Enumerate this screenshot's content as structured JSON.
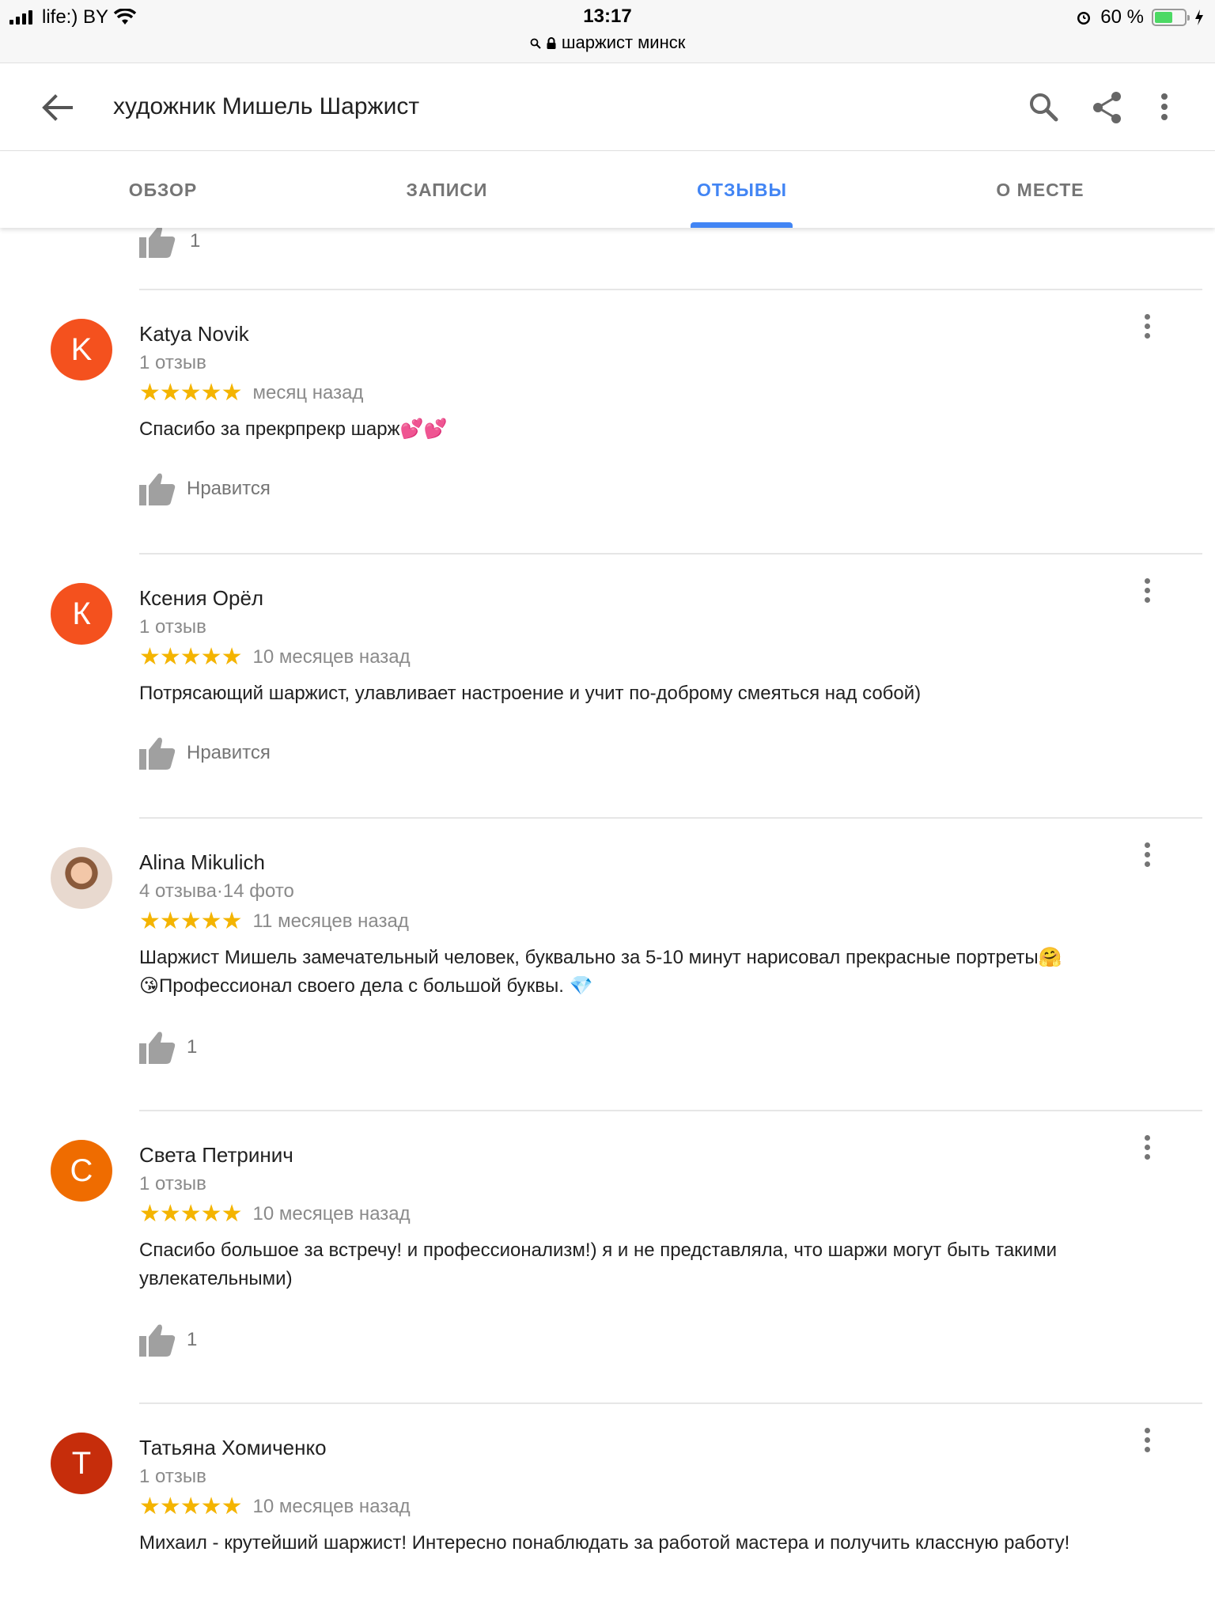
{
  "status_bar": {
    "carrier": "life:) BY",
    "time": "13:17",
    "url": "шаржист минск",
    "battery": "60 %",
    "battery_level": 0.6
  },
  "app_bar": {
    "title": "художник Мишель Шаржист",
    "icons": [
      "back-arrow-icon",
      "search-icon",
      "share-icon",
      "more-vert-icon"
    ]
  },
  "tabs": [
    {
      "label": "ОБЗОР",
      "active": false
    },
    {
      "label": "ЗАПИСИ",
      "active": false
    },
    {
      "label": "ОТЗЫВЫ",
      "active": true
    },
    {
      "label": "О МЕСТЕ",
      "active": false
    }
  ],
  "accent_color": "#4285f4",
  "star_color": "#f4b400",
  "previous_review_likes": "1",
  "reviews": [
    {
      "author": "Katya Novik",
      "avatar_letter": "K",
      "avatar_color": "#f4511e",
      "meta": "1 отзыв",
      "stars": "★★★★★",
      "date": "месяц назад",
      "text": "Спасибо за прекрпрекр шарж💕💕",
      "like": "Нравится"
    },
    {
      "author": "Ксения Орёл",
      "avatar_letter": "К",
      "avatar_color": "#f4511e",
      "meta": "1 отзыв",
      "stars": "★★★★★",
      "date": "10 месяцев назад",
      "text": "Потрясающий шаржист,  улавливает настроение и учит по-доброму смеяться над собой)",
      "like": "Нравится"
    },
    {
      "author": "Alina Mikulich",
      "avatar_letter": "",
      "avatar_color": "",
      "meta": "4 отзыва·14 фото",
      "stars": "★★★★★",
      "date": "11 месяцев назад",
      "text": "Шаржист Мишель замечательный человек, буквально за 5-10 минут нарисовал прекрасные портреты🤗😘Профессионал своего дела с большой буквы. 💎",
      "like": "1"
    },
    {
      "author": "Света Петринич",
      "avatar_letter": "С",
      "avatar_color": "#ef6c00",
      "meta": "1 отзыв",
      "stars": "★★★★★",
      "date": "10 месяцев назад",
      "text": "Спасибо большое за встречу! и профессионализм!) я и не представляла, что шаржи могут быть такими увлекательными)",
      "like": "1"
    },
    {
      "author": "Татьяна Хомиченко",
      "avatar_letter": "Т",
      "avatar_color": "#c62d0b",
      "meta": "1 отзыв",
      "stars": "★★★★★",
      "date": "10 месяцев назад",
      "text": "Михаил - крутейший шаржист! Интересно понаблюдать за работой мастера и получить классную работу!",
      "like": ""
    }
  ]
}
